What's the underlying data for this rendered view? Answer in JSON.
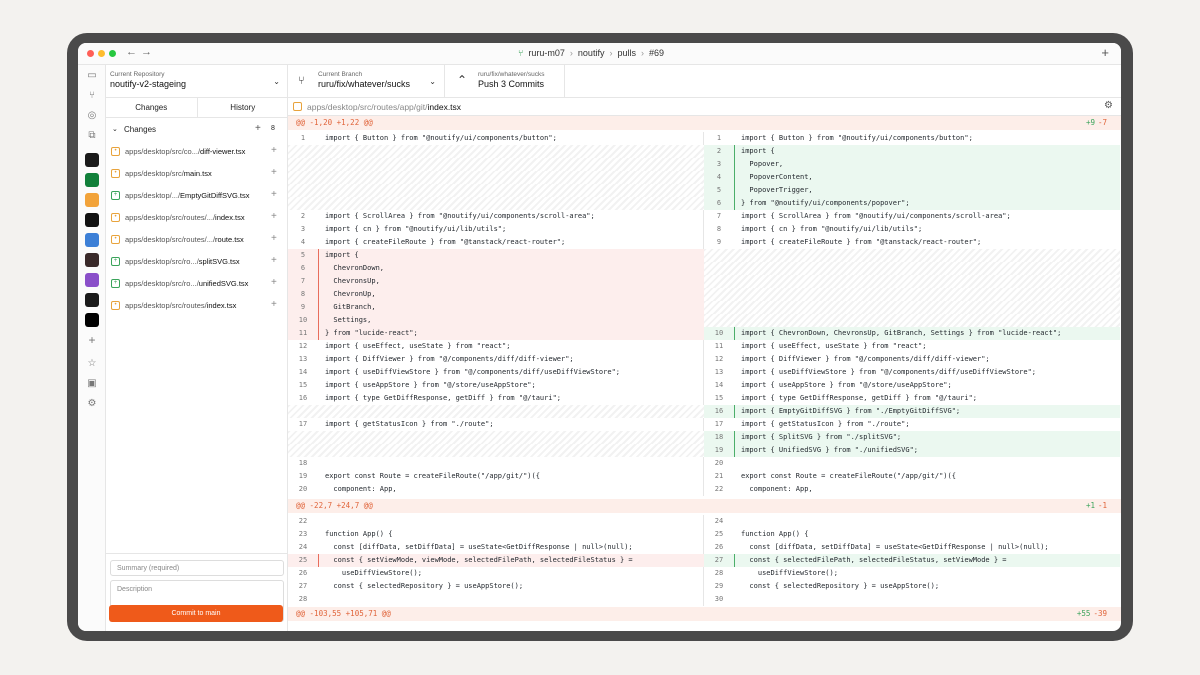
{
  "titlebar": {
    "breadcrumb": [
      "ruru-m07",
      "noutify",
      "pulls",
      "#69"
    ],
    "sep": "›"
  },
  "repo": {
    "label": "Current Repository",
    "value": "noutify-v2-stageing"
  },
  "tabs": [
    "Changes",
    "History"
  ],
  "changes": {
    "label": "Changes",
    "count": "8"
  },
  "files": [
    {
      "status": "mod",
      "dir": "apps/desktop/src/co.../",
      "name": "diff-viewer.tsx"
    },
    {
      "status": "mod",
      "dir": "apps/desktop/src/",
      "name": "main.tsx"
    },
    {
      "status": "add",
      "dir": "apps/desktop/.../",
      "name": "EmptyGitDiffSVG.tsx"
    },
    {
      "status": "mod",
      "dir": "apps/desktop/src/routes/.../",
      "name": "index.tsx"
    },
    {
      "status": "mod",
      "dir": "apps/desktop/src/routes/.../",
      "name": "route.tsx"
    },
    {
      "status": "add",
      "dir": "apps/desktop/src/ro.../",
      "name": "splitSVG.tsx"
    },
    {
      "status": "add",
      "dir": "apps/desktop/src/ro.../",
      "name": "unifiedSVG.tsx"
    },
    {
      "status": "mod",
      "dir": "apps/desktop/src/routes/",
      "name": "index.tsx"
    }
  ],
  "commit": {
    "summary_placeholder": "Summary (required)",
    "description_placeholder": "Description",
    "button": "Commit to main"
  },
  "branch": {
    "label": "Current Branch",
    "value": "ruru/fix/whatever/sucks"
  },
  "push": {
    "label": "ruru/fix/whatever/sucks",
    "value": "Push 3 Commits"
  },
  "path": {
    "dir": "apps/desktop/src/routes/app/git/",
    "file": "index.tsx"
  },
  "hunks": [
    {
      "header": "@@ -1,20 +1,22 @@",
      "add": "+9",
      "del": "-7"
    },
    {
      "header": "@@ -22,7 +24,7 @@",
      "add": "+1",
      "del": "-1"
    },
    {
      "header": "@@ -103,55 +105,71 @@",
      "add": "+55",
      "del": "-39"
    }
  ],
  "left": [
    {
      "n": "1",
      "c": "import { Button } from \"@noutify/ui/components/button\";",
      "t": "ctx"
    },
    {
      "n": "",
      "c": "",
      "t": "empty"
    },
    {
      "n": "",
      "c": "",
      "t": "empty"
    },
    {
      "n": "",
      "c": "",
      "t": "empty"
    },
    {
      "n": "",
      "c": "",
      "t": "empty"
    },
    {
      "n": "",
      "c": "",
      "t": "empty"
    },
    {
      "n": "2",
      "c": "import { ScrollArea } from \"@noutify/ui/components/scroll-area\";",
      "t": "ctx"
    },
    {
      "n": "3",
      "c": "import { cn } from \"@noutify/ui/lib/utils\";",
      "t": "ctx"
    },
    {
      "n": "4",
      "c": "import { createFileRoute } from \"@tanstack/react-router\";",
      "t": "ctx"
    },
    {
      "n": "5",
      "c": "import {",
      "t": "del"
    },
    {
      "n": "6",
      "c": "  ChevronDown,",
      "t": "del"
    },
    {
      "n": "7",
      "c": "  ChevronsUp,",
      "t": "del"
    },
    {
      "n": "8",
      "c": "  ChevronUp,",
      "t": "del"
    },
    {
      "n": "9",
      "c": "  GitBranch,",
      "t": "del"
    },
    {
      "n": "10",
      "c": "  Settings,",
      "t": "del"
    },
    {
      "n": "11",
      "c": "} from \"lucide-react\";",
      "t": "del"
    },
    {
      "n": "12",
      "c": "import { useEffect, useState } from \"react\";",
      "t": "ctx"
    },
    {
      "n": "13",
      "c": "import { DiffViewer } from \"@/components/diff/diff-viewer\";",
      "t": "ctx"
    },
    {
      "n": "14",
      "c": "import { useDiffViewStore } from \"@/components/diff/useDiffViewStore\";",
      "t": "ctx"
    },
    {
      "n": "15",
      "c": "import { useAppStore } from \"@/store/useAppStore\";",
      "t": "ctx"
    },
    {
      "n": "16",
      "c": "import { type GetDiffResponse, getDiff } from \"@/tauri\";",
      "t": "ctx"
    },
    {
      "n": "",
      "c": "",
      "t": "empty"
    },
    {
      "n": "17",
      "c": "import { getStatusIcon } from \"./route\";",
      "t": "ctx"
    },
    {
      "n": "",
      "c": "",
      "t": "empty"
    },
    {
      "n": "",
      "c": "",
      "t": "empty"
    },
    {
      "n": "18",
      "c": "",
      "t": "ctx"
    },
    {
      "n": "19",
      "c": "export const Route = createFileRoute(\"/app/git/\")({",
      "t": "ctx"
    },
    {
      "n": "20",
      "c": "  component: App,",
      "t": "ctx"
    }
  ],
  "right": [
    {
      "n": "1",
      "c": "import { Button } from \"@noutify/ui/components/button\";",
      "t": "ctx"
    },
    {
      "n": "2",
      "c": "import {",
      "t": "add"
    },
    {
      "n": "3",
      "c": "  Popover,",
      "t": "add"
    },
    {
      "n": "4",
      "c": "  PopoverContent,",
      "t": "add"
    },
    {
      "n": "5",
      "c": "  PopoverTrigger,",
      "t": "add"
    },
    {
      "n": "6",
      "c": "} from \"@noutify/ui/components/popover\";",
      "t": "add"
    },
    {
      "n": "7",
      "c": "import { ScrollArea } from \"@noutify/ui/components/scroll-area\";",
      "t": "ctx"
    },
    {
      "n": "8",
      "c": "import { cn } from \"@noutify/ui/lib/utils\";",
      "t": "ctx"
    },
    {
      "n": "9",
      "c": "import { createFileRoute } from \"@tanstack/react-router\";",
      "t": "ctx"
    },
    {
      "n": "",
      "c": "",
      "t": "empty"
    },
    {
      "n": "",
      "c": "",
      "t": "empty"
    },
    {
      "n": "",
      "c": "",
      "t": "empty"
    },
    {
      "n": "",
      "c": "",
      "t": "empty"
    },
    {
      "n": "",
      "c": "",
      "t": "empty"
    },
    {
      "n": "",
      "c": "",
      "t": "empty"
    },
    {
      "n": "10",
      "c": "import { ChevronDown, ChevronsUp, GitBranch, Settings } from \"lucide-react\";",
      "t": "add"
    },
    {
      "n": "11",
      "c": "import { useEffect, useState } from \"react\";",
      "t": "ctx"
    },
    {
      "n": "12",
      "c": "import { DiffViewer } from \"@/components/diff/diff-viewer\";",
      "t": "ctx"
    },
    {
      "n": "13",
      "c": "import { useDiffViewStore } from \"@/components/diff/useDiffViewStore\";",
      "t": "ctx"
    },
    {
      "n": "14",
      "c": "import { useAppStore } from \"@/store/useAppStore\";",
      "t": "ctx"
    },
    {
      "n": "15",
      "c": "import { type GetDiffResponse, getDiff } from \"@/tauri\";",
      "t": "ctx"
    },
    {
      "n": "16",
      "c": "import { EmptyGitDiffSVG } from \"./EmptyGitDiffSVG\";",
      "t": "add"
    },
    {
      "n": "17",
      "c": "import { getStatusIcon } from \"./route\";",
      "t": "ctx"
    },
    {
      "n": "18",
      "c": "import { SplitSVG } from \"./splitSVG\";",
      "t": "add"
    },
    {
      "n": "19",
      "c": "import { UnifiedSVG } from \"./unifiedSVG\";",
      "t": "add"
    },
    {
      "n": "20",
      "c": "",
      "t": "ctx"
    },
    {
      "n": "21",
      "c": "export const Route = createFileRoute(\"/app/git/\")({",
      "t": "ctx"
    },
    {
      "n": "22",
      "c": "  component: App,",
      "t": "ctx"
    }
  ],
  "left2": [
    {
      "n": "22",
      "c": "",
      "t": "ctx"
    },
    {
      "n": "23",
      "c": "function App() {",
      "t": "ctx"
    },
    {
      "n": "24",
      "c": "  const [diffData, setDiffData] = useState<GetDiffResponse | null>(null);",
      "t": "ctx"
    },
    {
      "n": "25",
      "c": "  const { setViewMode, viewMode, selectedFilePath, selectedFileStatus } =",
      "t": "del"
    },
    {
      "n": "26",
      "c": "    useDiffViewStore();",
      "t": "ctx"
    },
    {
      "n": "27",
      "c": "  const { selectedRepository } = useAppStore();",
      "t": "ctx"
    },
    {
      "n": "28",
      "c": "",
      "t": "ctx"
    }
  ],
  "right2": [
    {
      "n": "24",
      "c": "",
      "t": "ctx"
    },
    {
      "n": "25",
      "c": "function App() {",
      "t": "ctx"
    },
    {
      "n": "26",
      "c": "  const [diffData, setDiffData] = useState<GetDiffResponse | null>(null);",
      "t": "ctx"
    },
    {
      "n": "27",
      "c": "  const { selectedFilePath, selectedFileStatus, setViewMode } =",
      "t": "add"
    },
    {
      "n": "28",
      "c": "    useDiffViewStore();",
      "t": "ctx"
    },
    {
      "n": "29",
      "c": "  const { selectedRepository } = useAppStore();",
      "t": "ctx"
    },
    {
      "n": "30",
      "c": "",
      "t": "ctx"
    }
  ]
}
